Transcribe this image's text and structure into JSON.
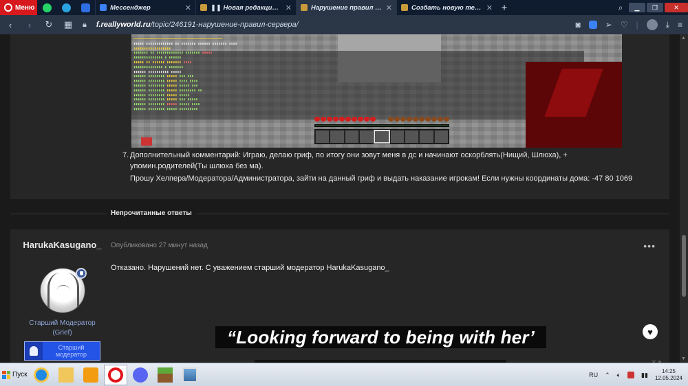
{
  "browser": {
    "menu_label": "Меню",
    "tabs": [
      {
        "title": "Мессенджер",
        "color": "#3b82f6"
      },
      {
        "title": "❚❚ Новая редакция прави",
        "color": "#7a5c2e"
      },
      {
        "title": "Нарушение правил серв",
        "color": "#7a5c2e"
      },
      {
        "title": "Создать новую тему - R",
        "color": "#7a5c2e"
      }
    ],
    "active_tab_index": 2,
    "url_domain": "f.reallyworld.ru",
    "url_path": "/topic/246191-нарушение-правил-сервера/"
  },
  "post1": {
    "item_number": "7.",
    "line1": "Дополнительный комментарий: Играю, делаю гриф, по итогу они зовут меня в дс и начинают оскорблять(Нищий, Шлюха), + упомин.родителей(Ты шлюха без ма).",
    "line2": "Прошу Хелпера/Модератора/Администратора, зайти на данный гриф и выдать наказание игрокам! Если нужны координаты дома: -47 80 1069"
  },
  "section_title": "Непрочитанные ответы",
  "post2": {
    "author": "HarukaKasugano_",
    "role": "Старший Модератор (Grief)",
    "rank_image_text": "Старший модератор",
    "meta_prefix": "Опубликовано",
    "meta_time": "27 минут назад",
    "body": "Отказано. Нарушений нет. С уважением старший модератор HarukaKasugano_",
    "more_icon": "ellipsis-icon",
    "like_icon": "heart-icon"
  },
  "quote_banner": "“Looking forward to being with her’",
  "taskbar": {
    "start_label": "Пуск",
    "lang": "RU",
    "time": "14:25",
    "date": "12.05.2024"
  }
}
